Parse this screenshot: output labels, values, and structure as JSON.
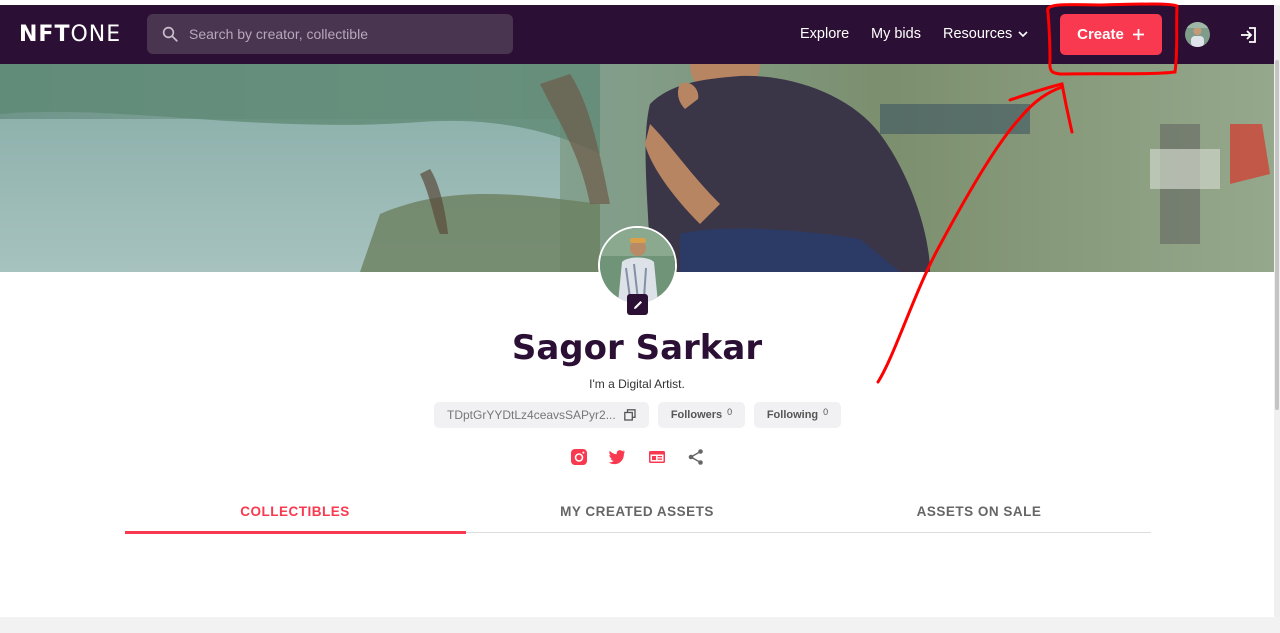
{
  "header": {
    "logo_nft": "NFT",
    "logo_one": "ONE",
    "search_placeholder": "Search by creator, collectible",
    "nav": {
      "explore": "Explore",
      "my_bids": "My bids",
      "resources": "Resources"
    },
    "create_label": "Create"
  },
  "profile": {
    "name": "Sagor Sarkar",
    "bio": "I'm a Digital Artist.",
    "wallet": "TDptGrYYDtLz4ceavsSAPyr2...",
    "followers_label": "Followers",
    "followers_count": "0",
    "following_label": "Following",
    "following_count": "0"
  },
  "social": [
    "instagram-icon",
    "twitter-icon",
    "website-icon",
    "share-icon"
  ],
  "tabs": {
    "collectibles": "COLLECTIBLES",
    "created": "MY CREATED ASSETS",
    "on_sale": "ASSETS ON SALE"
  },
  "colors": {
    "navbar": "#2b0f34",
    "accent": "#f8394f",
    "annotation": "#ff0000"
  }
}
